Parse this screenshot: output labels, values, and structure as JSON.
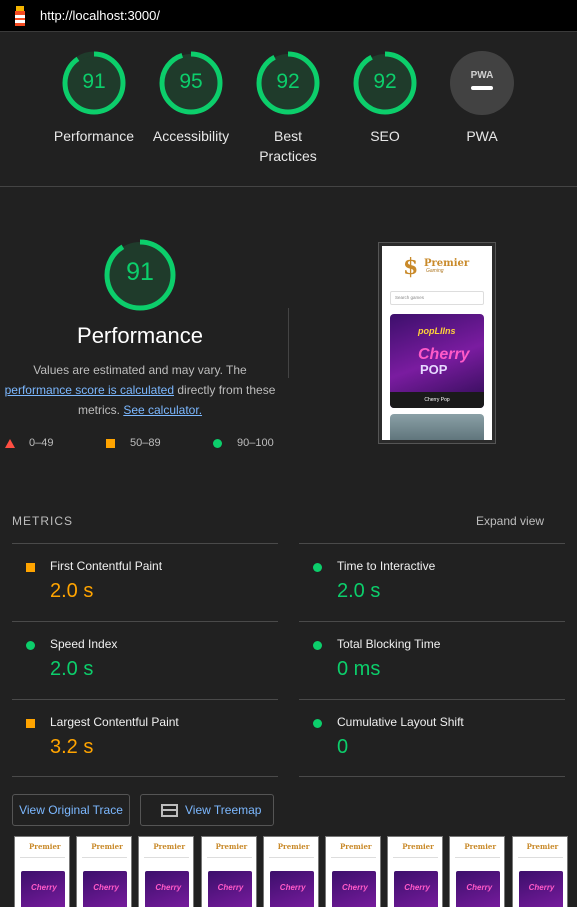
{
  "browser": {
    "url": "http://localhost:3000/"
  },
  "categories": [
    {
      "label": "Performance",
      "score": "91"
    },
    {
      "label": "Accessibility",
      "score": "95"
    },
    {
      "label": "Best Practices",
      "score": "92"
    },
    {
      "label": "SEO",
      "score": "92"
    },
    {
      "label": "PWA",
      "badge": "PWA"
    }
  ],
  "performance": {
    "score": "91",
    "title": "Performance",
    "desc_1": "Values are estimated and may vary. The",
    "desc_link1": "performance score is calculated",
    "desc_2": " directly from these",
    "desc_3": "metrics. ",
    "desc_link2": "See calculator.",
    "legend": {
      "poor": "0–49",
      "average": "50–89",
      "good": "90–100"
    }
  },
  "screenshot": {
    "brand": "Premier",
    "brand_sub": "Gaming",
    "search_placeholder": "Search games",
    "card_logo": "popLIIns",
    "card_name": "Cherry",
    "card_name2": "POP",
    "card_caption": "Cherry Pop"
  },
  "metrics": {
    "heading": "METRICS",
    "expand_label": "Expand view",
    "items": [
      {
        "name": "First Contentful Paint",
        "value": "2.0 s",
        "status": "average"
      },
      {
        "name": "Time to Interactive",
        "value": "2.0 s",
        "status": "good"
      },
      {
        "name": "Speed Index",
        "value": "2.0 s",
        "status": "good"
      },
      {
        "name": "Total Blocking Time",
        "value": "0 ms",
        "status": "good"
      },
      {
        "name": "Largest Contentful Paint",
        "value": "3.2 s",
        "status": "average"
      },
      {
        "name": "Cumulative Layout Shift",
        "value": "0",
        "status": "good"
      }
    ]
  },
  "buttons": {
    "trace": "View Original Trace",
    "treemap": "View Treemap"
  },
  "filmstrip": {
    "frame_brand": "Premier",
    "frame_card": "Cherry",
    "count": 9
  },
  "colors": {
    "good": "#0cce6b",
    "average": "#ffa400",
    "poor": "#ff4e42",
    "link": "#7cb8ff"
  }
}
